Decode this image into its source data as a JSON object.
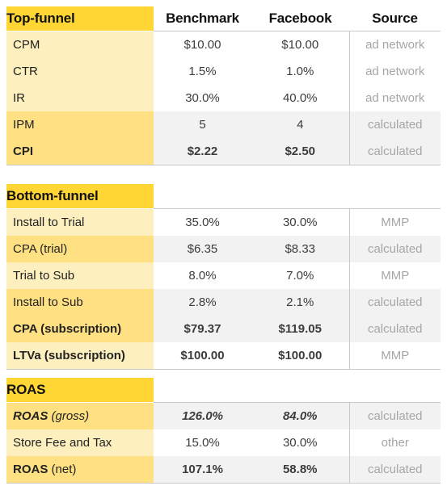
{
  "table": {
    "columns": {
      "label": "",
      "benchmark": "Benchmark",
      "facebook": "Facebook",
      "source": "Source"
    },
    "sections": [
      {
        "id": "top-funnel",
        "title": "Top-funnel",
        "rows": [
          {
            "label": "CPM",
            "benchmark": "$10.00",
            "facebook": "$10.00",
            "source": "ad network",
            "tint": "light",
            "databg": "white",
            "bold": false
          },
          {
            "label": "CTR",
            "benchmark": "1.5%",
            "facebook": "1.0%",
            "source": "ad network",
            "tint": "light",
            "databg": "white",
            "bold": false
          },
          {
            "label": "IR",
            "benchmark": "30.0%",
            "facebook": "40.0%",
            "source": "ad network",
            "tint": "light",
            "databg": "white",
            "bold": false
          },
          {
            "label": "IPM",
            "benchmark": "5",
            "facebook": "4",
            "source": "calculated",
            "tint": "deep",
            "databg": "gray",
            "bold": false
          },
          {
            "label": "CPI",
            "benchmark": "$2.22",
            "facebook": "$2.50",
            "source": "calculated",
            "tint": "deep",
            "databg": "gray",
            "bold": true
          }
        ]
      },
      {
        "id": "bottom-funnel",
        "title": "Bottom-funnel",
        "rows": [
          {
            "label": "Install to Trial",
            "benchmark": "35.0%",
            "facebook": "30.0%",
            "source": "MMP",
            "tint": "light",
            "databg": "white",
            "bold": false
          },
          {
            "label": "CPA (trial)",
            "benchmark": "$6.35",
            "facebook": "$8.33",
            "source": "calculated",
            "tint": "deep",
            "databg": "gray",
            "bold": false
          },
          {
            "label": "Trial to Sub",
            "benchmark": "8.0%",
            "facebook": "7.0%",
            "source": "MMP",
            "tint": "light",
            "databg": "white",
            "bold": false
          },
          {
            "label": "Install to Sub",
            "benchmark": "2.8%",
            "facebook": "2.1%",
            "source": "calculated",
            "tint": "deep",
            "databg": "gray",
            "bold": false
          },
          {
            "label": "CPA (subscription)",
            "benchmark": "$79.37",
            "facebook": "$119.05",
            "source": "calculated",
            "tint": "deep",
            "databg": "gray",
            "bold": true
          },
          {
            "label": "LTVa (subscription)",
            "benchmark": "$100.00",
            "facebook": "$100.00",
            "source": "MMP",
            "tint": "light",
            "databg": "white",
            "bold": true
          }
        ]
      },
      {
        "id": "roas",
        "title": "ROAS",
        "rows": [
          {
            "label_strong": "ROAS",
            "label_weak": " (gross)",
            "benchmark": "126.0%",
            "facebook": "84.0%",
            "source": "calculated",
            "tint": "deep",
            "databg": "gray",
            "bold": true,
            "italic": true
          },
          {
            "label": "Store Fee and Tax",
            "benchmark": "15.0%",
            "facebook": "30.0%",
            "source": "other",
            "tint": "light",
            "databg": "white",
            "bold": false,
            "italic": false
          },
          {
            "label_strong": "ROAS",
            "label_weak": " (net)",
            "benchmark": "107.1%",
            "facebook": "58.8%",
            "source": "calculated",
            "tint": "deep",
            "databg": "gray",
            "bold": true,
            "italic": false
          }
        ]
      }
    ]
  },
  "colors": {
    "header_yellow": "#FFD633",
    "tint_light": "#FDEFBE",
    "tint_deep": "#FFE082",
    "data_gray": "#F2F2F2",
    "source_text": "#A6A6A6",
    "border": "#C9C9C9"
  }
}
